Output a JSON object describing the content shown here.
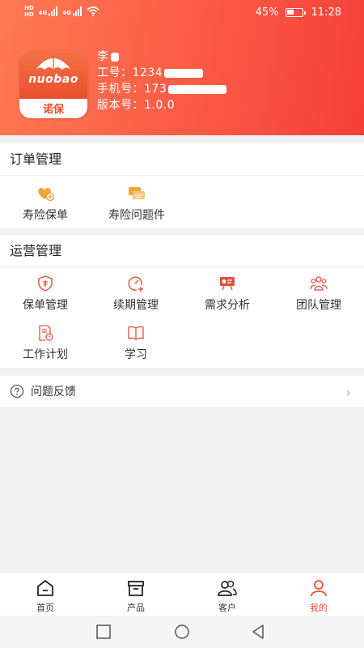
{
  "status_bar": {
    "sim_label_1": "HD",
    "sim_label_2": "HD",
    "network_1": "4G",
    "network_2": "4G",
    "battery": "45%",
    "time": "11:28"
  },
  "profile": {
    "logo_word": "nuobao",
    "logo_cn": "诺保",
    "name": "李",
    "employee_id_label": "工号：",
    "employee_id_value": "1234",
    "phone_label": "手机号：",
    "phone_value": "173",
    "version_label": "版本号：",
    "version_value": "1.0.0"
  },
  "order_management": {
    "title": "订单管理",
    "items": [
      {
        "label": "寿险保单",
        "icon": "heart-plus-icon"
      },
      {
        "label": "寿险问题件",
        "icon": "chat-bubbles-icon"
      }
    ]
  },
  "operations_management": {
    "title": "运营管理",
    "items": [
      {
        "label": "保单管理",
        "icon": "shield-icon"
      },
      {
        "label": "续期管理",
        "icon": "gauge-plus-icon"
      },
      {
        "label": "需求分析",
        "icon": "analysis-board-icon"
      },
      {
        "label": "团队管理",
        "icon": "team-icon"
      },
      {
        "label": "工作计划",
        "icon": "plan-document-icon"
      },
      {
        "label": "学习",
        "icon": "book-icon"
      }
    ]
  },
  "feedback": {
    "label": "问题反馈",
    "icon": "question-circle-icon"
  },
  "tabbar": {
    "tabs": [
      {
        "label": "首页",
        "icon": "home-icon"
      },
      {
        "label": "产品",
        "icon": "product-box-icon"
      },
      {
        "label": "客户",
        "icon": "customers-icon"
      },
      {
        "label": "我的",
        "icon": "user-icon"
      }
    ],
    "active_index": 3
  },
  "colors": {
    "accent": "#e8503a",
    "header_start": "#ff7a52",
    "header_end": "#f53f3a",
    "icon_orange": "#f0a53a",
    "icon_red": "#e0503c"
  }
}
